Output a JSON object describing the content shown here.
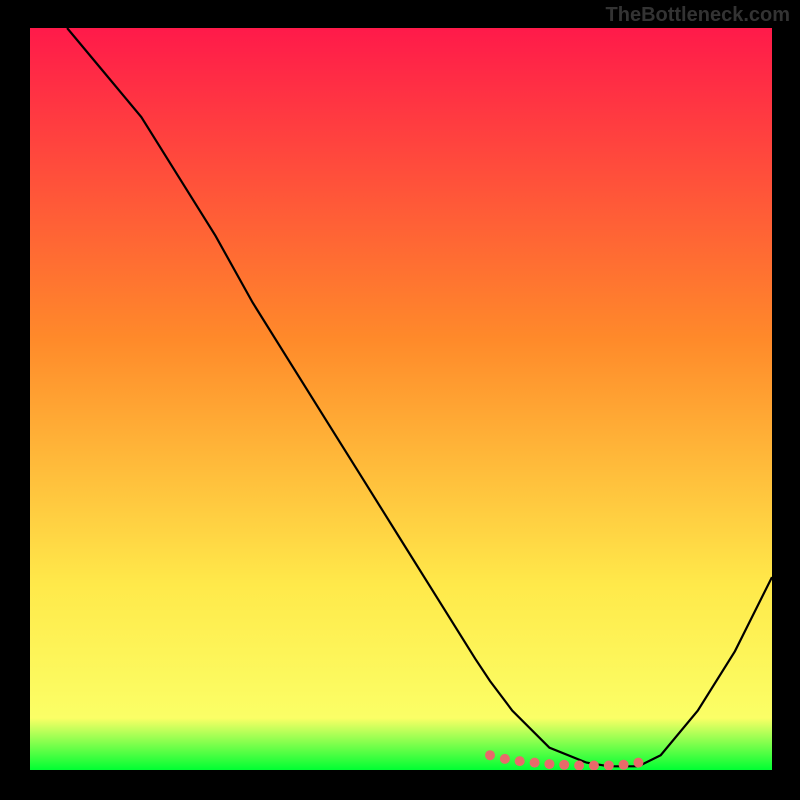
{
  "watermark": "TheBottleneck.com",
  "colors": {
    "grad_top": "#ff1a4a",
    "grad_mid1": "#ff8a2a",
    "grad_mid2": "#ffe94a",
    "grad_mid3": "#fbff66",
    "grad_bottom": "#00ff33",
    "curve": "#000000",
    "marker": "#e86a6a",
    "background": "#000000"
  },
  "chart_data": {
    "type": "line",
    "title": "",
    "xlabel": "",
    "ylabel": "",
    "xlim": [
      0,
      100
    ],
    "ylim": [
      0,
      100
    ],
    "series": [
      {
        "name": "curve",
        "x": [
          5,
          10,
          15,
          20,
          25,
          30,
          35,
          40,
          45,
          50,
          55,
          60,
          62,
          65,
          70,
          75,
          78,
          80,
          82,
          85,
          90,
          95,
          100
        ],
        "y": [
          100,
          94,
          88,
          80,
          72,
          63,
          55,
          47,
          39,
          31,
          23,
          15,
          12,
          8,
          3,
          1,
          0.5,
          0.5,
          0.5,
          2,
          8,
          16,
          26
        ]
      },
      {
        "name": "bottom-markers",
        "x": [
          62,
          64,
          66,
          68,
          70,
          72,
          74,
          76,
          78,
          80,
          82
        ],
        "y": [
          2,
          1.5,
          1.2,
          1,
          0.8,
          0.7,
          0.6,
          0.6,
          0.6,
          0.7,
          1
        ]
      }
    ]
  }
}
